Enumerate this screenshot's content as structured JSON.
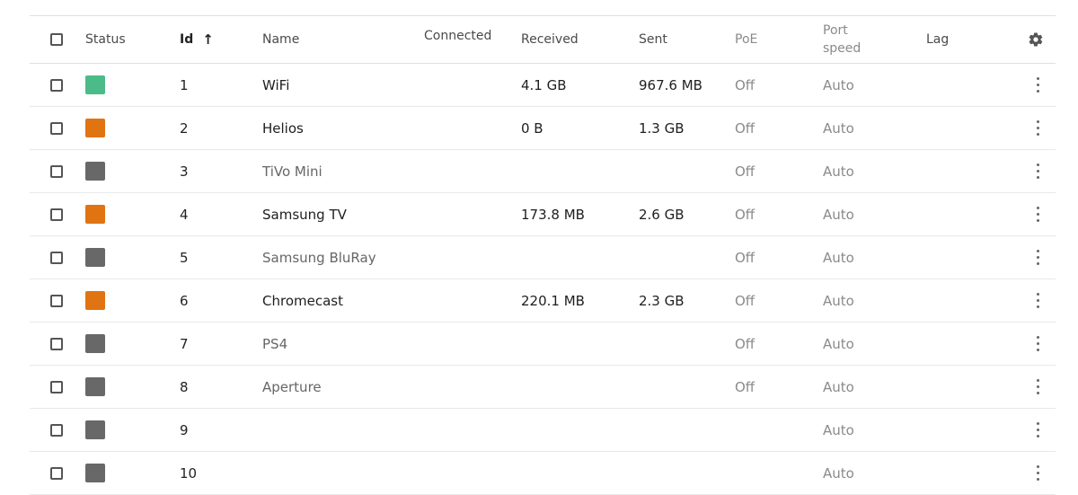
{
  "headers": {
    "status": "Status",
    "id": "Id",
    "id_sort_icon": "arrow-up-icon",
    "name": "Name",
    "connected": "Connected",
    "received": "Received",
    "sent": "Sent",
    "poe": "PoE",
    "port_speed_line1": "Port",
    "port_speed_line2": "speed",
    "lag": "Lag",
    "settings_icon": "gear-icon"
  },
  "colors": {
    "connected": "#4cbb8a",
    "warning": "#e07412",
    "disconnected": "#686868"
  },
  "rows": [
    {
      "id": "1",
      "name": "WiFi",
      "status": "connected",
      "received": "4.1 GB",
      "sent": "967.6 MB",
      "poe": "Off",
      "speed": "Auto"
    },
    {
      "id": "2",
      "name": "Helios",
      "status": "warning",
      "received": "0 B",
      "sent": "1.3 GB",
      "poe": "Off",
      "speed": "Auto"
    },
    {
      "id": "3",
      "name": "TiVo Mini",
      "status": "disconnected",
      "received": "",
      "sent": "",
      "poe": "Off",
      "speed": "Auto"
    },
    {
      "id": "4",
      "name": "Samsung TV",
      "status": "warning",
      "received": "173.8 MB",
      "sent": "2.6 GB",
      "poe": "Off",
      "speed": "Auto"
    },
    {
      "id": "5",
      "name": "Samsung BluRay",
      "status": "disconnected",
      "received": "",
      "sent": "",
      "poe": "Off",
      "speed": "Auto"
    },
    {
      "id": "6",
      "name": "Chromecast",
      "status": "warning",
      "received": "220.1 MB",
      "sent": "2.3 GB",
      "poe": "Off",
      "speed": "Auto"
    },
    {
      "id": "7",
      "name": "PS4",
      "status": "disconnected",
      "received": "",
      "sent": "",
      "poe": "Off",
      "speed": "Auto"
    },
    {
      "id": "8",
      "name": "Aperture",
      "status": "disconnected",
      "received": "",
      "sent": "",
      "poe": "Off",
      "speed": "Auto"
    },
    {
      "id": "9",
      "name": "",
      "status": "disconnected",
      "received": "",
      "sent": "",
      "poe": "",
      "speed": "Auto"
    },
    {
      "id": "10",
      "name": "",
      "status": "disconnected",
      "received": "",
      "sent": "",
      "poe": "",
      "speed": "Auto"
    }
  ]
}
